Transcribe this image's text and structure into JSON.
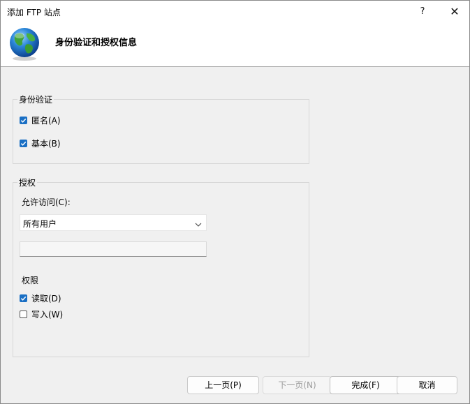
{
  "window": {
    "title": "添加 FTP 站点",
    "help_glyph": "?",
    "close_glyph": "✕"
  },
  "header": {
    "title": "身份验证和授权信息",
    "icon": "globe-icon"
  },
  "authentication": {
    "group_label": "身份验证",
    "anonymous": {
      "label": "匿名(A)",
      "checked": true
    },
    "basic": {
      "label": "基本(B)",
      "checked": true
    }
  },
  "authorization": {
    "group_label": "授权",
    "allow_access_label": "允许访问(C):",
    "allow_access_value": "所有用户",
    "users_input_value": "",
    "permissions_label": "权限",
    "read": {
      "label": "读取(D)",
      "checked": true
    },
    "write": {
      "label": "写入(W)",
      "checked": false
    }
  },
  "buttons": {
    "previous": "上一页(P)",
    "next": "下一页(N)",
    "finish": "完成(F)",
    "cancel": "取消"
  },
  "colors": {
    "checkbox_checked": "#1a6fc4",
    "background": "#f0f0f0",
    "header_background": "#ffffff"
  }
}
